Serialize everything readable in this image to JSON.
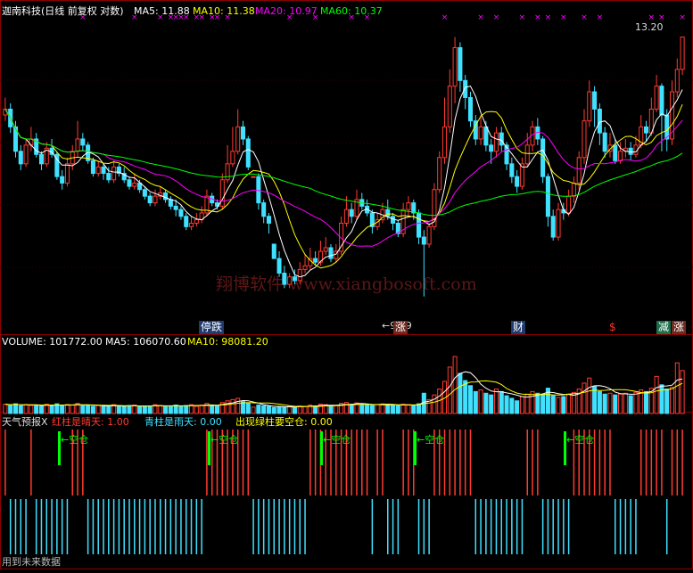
{
  "theme": {
    "up": "#ff3b30",
    "down": "#40e0ff",
    "ma5": "#ffffff",
    "ma10": "#ffff00",
    "ma20": "#ff00ff",
    "ma60": "#00ff00",
    "bg": "#000000",
    "frame": "#8b0000",
    "grid": "#3a0000",
    "spring": "#00ff00"
  },
  "main_header": {
    "title": "迦南科技(日线 前复权 对数)",
    "ma5": "MA5: 11.88",
    "ma10": "MA10: 11.38",
    "ma20": "MA20: 10.97",
    "ma60": "MA60: 10.37"
  },
  "watermark": "翔博软件 www.xiangbosoft.com",
  "tags": {
    "drop": "停跌",
    "rise": "涨",
    "finance": "财",
    "dollar": "$",
    "reduce": "减",
    "reduce_rise": "涨"
  },
  "annotations": {
    "high_price": "13.20",
    "low_price": "←9.09"
  },
  "volume_header": {
    "volume": "VOLUME: 101772.00",
    "ma5": "MA5: 106070.60",
    "ma10": "MA10: 98081.20"
  },
  "indicator_header": {
    "title": "天气预报X",
    "red": "红柱是晴天: 1.00",
    "cyan": "青柱是雨天: 0.00",
    "green": "出现绿柱要空仓: 0.00"
  },
  "signal_label": "←空仓",
  "footer": "用到未来数据",
  "chart_data": {
    "type": "candlestick",
    "price": {
      "ylim": [
        8.8,
        13.5
      ],
      "candles": [
        [
          11.8,
          11.9,
          12.1,
          11.7
        ],
        [
          11.9,
          11.6,
          12.0,
          11.5
        ],
        [
          11.6,
          11.2,
          11.7,
          11.1
        ],
        [
          11.2,
          11.0,
          11.3,
          10.9
        ],
        [
          11.0,
          11.3,
          11.4,
          10.95
        ],
        [
          11.3,
          11.4,
          11.6,
          11.2
        ],
        [
          11.4,
          11.15,
          11.5,
          11.1
        ],
        [
          11.15,
          11.0,
          11.2,
          10.9
        ],
        [
          11.0,
          11.25,
          11.35,
          10.95
        ],
        [
          11.25,
          11.15,
          11.4,
          11.1
        ],
        [
          11.15,
          10.8,
          11.2,
          10.75
        ],
        [
          10.8,
          10.7,
          10.9,
          10.6
        ],
        [
          10.7,
          11.0,
          11.1,
          10.65
        ],
        [
          11.0,
          11.2,
          11.3,
          10.9
        ],
        [
          11.2,
          11.4,
          11.7,
          11.1
        ],
        [
          11.4,
          11.3,
          11.5,
          11.2
        ],
        [
          11.3,
          11.05,
          11.35,
          11.0
        ],
        [
          11.05,
          10.85,
          11.1,
          10.8
        ],
        [
          10.85,
          10.95,
          11.05,
          10.8
        ],
        [
          10.95,
          10.85,
          11.0,
          10.75
        ],
        [
          10.85,
          10.75,
          10.95,
          10.7
        ],
        [
          10.75,
          10.95,
          11.05,
          10.7
        ],
        [
          10.95,
          10.85,
          11.0,
          10.8
        ],
        [
          10.85,
          10.75,
          10.95,
          10.7
        ],
        [
          10.75,
          10.65,
          10.8,
          10.6
        ],
        [
          10.65,
          10.7,
          10.85,
          10.6
        ],
        [
          10.7,
          10.6,
          10.75,
          10.55
        ],
        [
          10.6,
          10.5,
          10.65,
          10.45
        ],
        [
          10.5,
          10.4,
          10.55,
          10.35
        ],
        [
          10.4,
          10.5,
          10.6,
          10.35
        ],
        [
          10.5,
          10.55,
          10.65,
          10.45
        ],
        [
          10.55,
          10.45,
          10.6,
          10.4
        ],
        [
          10.45,
          10.35,
          10.5,
          10.3
        ],
        [
          10.35,
          10.3,
          10.45,
          10.2
        ],
        [
          10.3,
          10.2,
          10.35,
          10.15
        ],
        [
          10.2,
          10.05,
          10.25,
          10.0
        ],
        [
          10.05,
          10.1,
          10.2,
          10.0
        ],
        [
          10.1,
          10.15,
          10.25,
          10.05
        ],
        [
          10.15,
          10.25,
          10.35,
          10.1
        ],
        [
          10.25,
          10.5,
          10.6,
          10.2
        ],
        [
          10.5,
          10.4,
          10.55,
          10.35
        ],
        [
          10.4,
          10.35,
          10.45,
          10.3
        ],
        [
          10.35,
          10.75,
          10.85,
          10.3
        ],
        [
          10.75,
          11.0,
          11.3,
          10.7
        ],
        [
          11.0,
          11.2,
          11.6,
          10.95
        ],
        [
          11.2,
          11.6,
          11.9,
          11.15
        ],
        [
          11.6,
          11.4,
          11.7,
          11.3
        ],
        [
          11.4,
          10.95,
          11.45,
          10.9
        ],
        [
          10.8,
          10.8,
          10.8,
          10.8
        ],
        [
          10.8,
          10.4,
          10.85,
          10.3
        ],
        [
          10.4,
          10.2,
          10.45,
          10.1
        ],
        [
          10.2,
          10.1,
          10.25,
          9.95
        ],
        [
          9.8,
          9.6,
          9.8,
          9.6
        ],
        [
          9.6,
          9.4,
          9.7,
          9.35
        ],
        [
          9.4,
          9.25,
          9.5,
          9.2
        ],
        [
          9.25,
          9.35,
          9.4,
          9.2
        ],
        [
          9.35,
          9.3,
          9.45,
          9.25
        ],
        [
          9.3,
          9.45,
          9.55,
          9.25
        ],
        [
          9.45,
          9.5,
          9.65,
          9.4
        ],
        [
          9.5,
          9.6,
          9.75,
          9.45
        ],
        [
          9.6,
          9.55,
          9.7,
          9.5
        ],
        [
          9.55,
          9.7,
          9.85,
          9.5
        ],
        [
          9.7,
          9.75,
          9.9,
          9.65
        ],
        [
          9.75,
          9.6,
          9.8,
          9.55
        ],
        [
          9.6,
          9.7,
          9.8,
          9.55
        ],
        [
          9.7,
          10.1,
          10.2,
          9.65
        ],
        [
          10.1,
          10.3,
          10.5,
          10.05
        ],
        [
          10.3,
          10.2,
          10.4,
          10.1
        ],
        [
          10.2,
          10.45,
          10.6,
          10.15
        ],
        [
          10.45,
          10.35,
          10.55,
          10.3
        ],
        [
          10.35,
          10.25,
          10.45,
          10.2
        ],
        [
          10.25,
          10.05,
          10.3,
          9.95
        ],
        [
          10.05,
          10.15,
          10.25,
          10.0
        ],
        [
          10.15,
          10.3,
          10.4,
          10.1
        ],
        [
          10.3,
          10.2,
          10.45,
          10.15
        ],
        [
          10.2,
          10.1,
          10.25,
          10.0
        ],
        [
          10.1,
          9.95,
          10.15,
          9.9
        ],
        [
          9.95,
          10.3,
          10.4,
          9.9
        ],
        [
          10.3,
          10.4,
          10.5,
          10.2
        ],
        [
          10.4,
          10.25,
          10.45,
          10.15
        ],
        [
          10.25,
          9.9,
          10.3,
          9.8
        ],
        [
          9.9,
          9.8,
          10.0,
          9.09
        ],
        [
          9.8,
          10.05,
          10.1,
          9.75
        ],
        [
          10.05,
          10.6,
          10.7,
          10.0
        ],
        [
          10.6,
          11.1,
          11.2,
          10.55
        ],
        [
          11.1,
          11.6,
          12.1,
          11.0
        ],
        [
          11.6,
          12.3,
          12.6,
          11.5
        ],
        [
          12.3,
          13.0,
          13.2,
          12.0
        ],
        [
          13.0,
          12.4,
          13.1,
          12.2
        ],
        [
          12.4,
          12.1,
          12.5,
          11.9
        ],
        [
          12.1,
          11.7,
          12.2,
          11.6
        ],
        [
          11.7,
          11.4,
          11.8,
          11.3
        ],
        [
          11.4,
          11.6,
          11.8,
          11.3
        ],
        [
          11.6,
          11.3,
          11.7,
          11.2
        ],
        [
          11.3,
          11.2,
          11.4,
          11.0
        ],
        [
          11.2,
          11.5,
          11.6,
          11.1
        ],
        [
          11.5,
          11.3,
          11.6,
          11.2
        ],
        [
          11.3,
          11.0,
          11.35,
          10.9
        ],
        [
          11.0,
          10.8,
          11.1,
          10.7
        ],
        [
          10.8,
          10.65,
          10.9,
          10.55
        ],
        [
          10.65,
          11.0,
          11.1,
          10.6
        ],
        [
          11.0,
          11.3,
          11.5,
          10.95
        ],
        [
          11.3,
          11.6,
          11.7,
          11.2
        ],
        [
          11.6,
          11.4,
          11.75,
          11.3
        ],
        [
          11.4,
          10.8,
          11.45,
          10.7
        ],
        [
          10.8,
          10.2,
          10.85,
          10.05
        ],
        [
          10.2,
          9.9,
          10.3,
          9.85
        ],
        [
          9.9,
          10.3,
          10.4,
          9.85
        ],
        [
          10.3,
          10.25,
          10.4,
          10.15
        ],
        [
          10.25,
          10.5,
          10.6,
          10.2
        ],
        [
          10.5,
          10.7,
          10.8,
          10.4
        ],
        [
          10.7,
          11.1,
          11.2,
          10.6
        ],
        [
          11.1,
          11.7,
          11.9,
          11.0
        ],
        [
          11.7,
          12.2,
          12.4,
          11.6
        ],
        [
          12.2,
          11.9,
          12.3,
          11.6
        ],
        [
          11.9,
          11.5,
          12.0,
          11.3
        ],
        [
          11.5,
          11.2,
          11.6,
          11.1
        ],
        [
          11.2,
          11.3,
          11.5,
          11.1
        ],
        [
          11.3,
          11.05,
          11.4,
          11.0
        ],
        [
          11.05,
          11.2,
          11.35,
          11.0
        ],
        [
          11.2,
          11.25,
          11.4,
          11.1
        ],
        [
          11.25,
          11.15,
          11.35,
          11.05
        ],
        [
          11.15,
          11.3,
          11.45,
          11.1
        ],
        [
          11.3,
          11.6,
          11.8,
          11.25
        ],
        [
          11.6,
          11.5,
          11.7,
          11.35
        ],
        [
          11.5,
          11.9,
          12.1,
          11.45
        ],
        [
          11.9,
          12.3,
          12.5,
          11.85
        ],
        [
          12.3,
          11.8,
          12.35,
          11.2
        ],
        [
          11.8,
          11.4,
          11.9,
          11.2
        ],
        [
          11.4,
          12.2,
          12.4,
          11.3
        ],
        [
          12.2,
          12.6,
          12.8,
          12.1
        ],
        [
          12.6,
          13.2,
          13.2,
          12.5
        ]
      ]
    },
    "volume": {
      "ylim": [
        0,
        150000
      ],
      "values": [
        22000,
        20000,
        23000,
        18000,
        21000,
        19000,
        20000,
        17000,
        22000,
        18000,
        23000,
        19000,
        21000,
        20000,
        24000,
        18000,
        20000,
        17000,
        19000,
        16000,
        18000,
        21000,
        17000,
        16000,
        19000,
        20000,
        17000,
        16000,
        18000,
        21000,
        19000,
        17000,
        16000,
        20000,
        18000,
        19000,
        21000,
        17000,
        20000,
        24000,
        19000,
        18000,
        26000,
        30000,
        33000,
        36000,
        28000,
        24000,
        15000,
        20000,
        18000,
        17000,
        14000,
        16000,
        15000,
        17000,
        15000,
        18000,
        17000,
        20000,
        18000,
        22000,
        21000,
        17000,
        19000,
        24000,
        26000,
        22000,
        25000,
        21000,
        20000,
        19000,
        21000,
        23000,
        20000,
        19000,
        18000,
        22000,
        21000,
        20000,
        23000,
        48000,
        33000,
        44000,
        58000,
        76000,
        110000,
        135000,
        95000,
        78000,
        66000,
        52000,
        56000,
        48000,
        44000,
        58000,
        52000,
        42000,
        36000,
        30000,
        40000,
        46000,
        52000,
        48000,
        46000,
        60000,
        42000,
        38000,
        40000,
        46000,
        50000,
        58000,
        72000,
        84000,
        64000,
        52000,
        46000,
        48000,
        44000,
        46000,
        48000,
        42000,
        50000,
        56000,
        52000,
        60000,
        88000,
        68000,
        58000,
        62000,
        120000,
        101772
      ]
    }
  }
}
